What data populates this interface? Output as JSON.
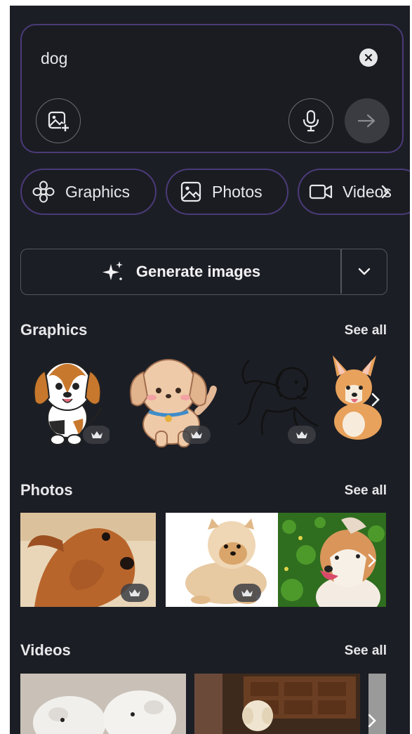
{
  "search": {
    "value": "dog"
  },
  "chips": [
    {
      "label": "Graphics",
      "icon": "flower-icon"
    },
    {
      "label": "Photos",
      "icon": "image-icon"
    },
    {
      "label": "Videos",
      "icon": "video-camera-icon"
    }
  ],
  "generate": {
    "label": "Generate images"
  },
  "sections": [
    {
      "title": "Graphics",
      "see_all": "See all"
    },
    {
      "title": "Photos",
      "see_all": "See all"
    },
    {
      "title": "Videos",
      "see_all": "See all"
    }
  ],
  "colors": {
    "panel_bg": "#1c1e25",
    "accent_border": "#4b3a78",
    "text": "#e8e8ea"
  }
}
